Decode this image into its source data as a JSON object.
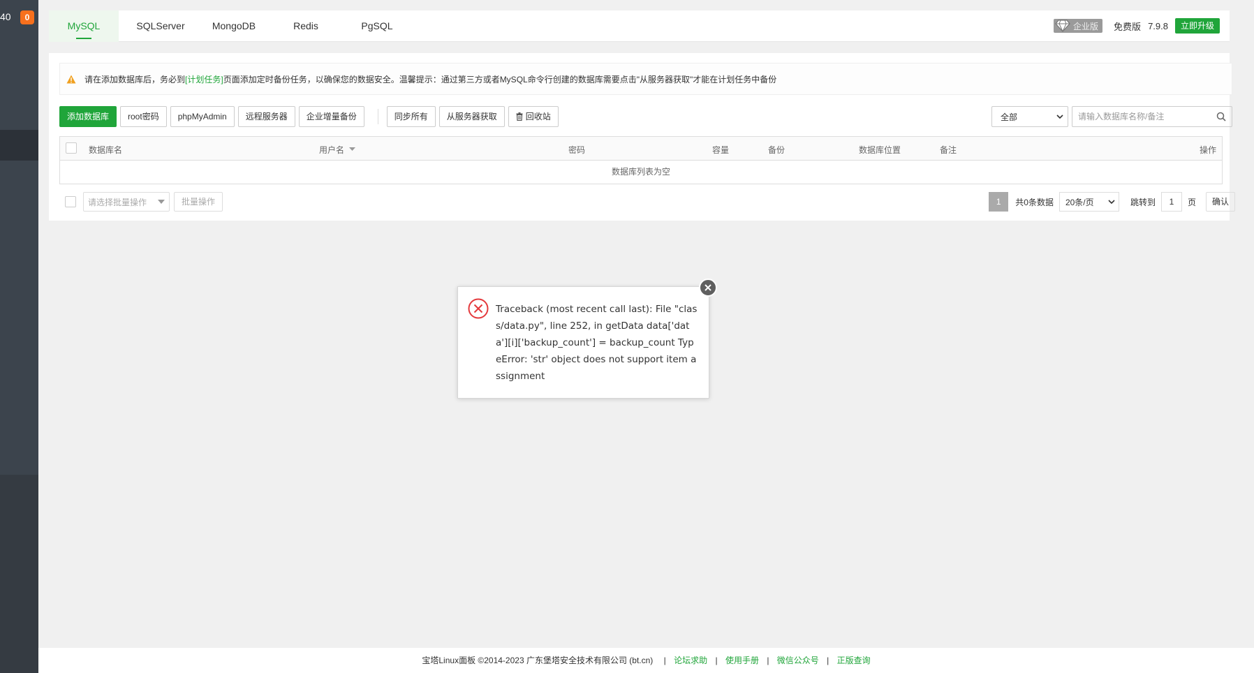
{
  "sidebar": {
    "number": "40",
    "badge": "0"
  },
  "tabs": [
    {
      "label": "MySQL",
      "active": true
    },
    {
      "label": "SQLServer",
      "active": false
    },
    {
      "label": "MongoDB",
      "active": false
    },
    {
      "label": "Redis",
      "active": false
    },
    {
      "label": "PgSQL",
      "active": false
    }
  ],
  "header_right": {
    "enterprise": "企业版",
    "free": "免费版",
    "version": "7.9.8",
    "upgrade": "立即升级"
  },
  "notice": {
    "prefix": "请在添加数据库后，务必到",
    "link": "[计划任务]",
    "suffix": "页面添加定时备份任务，以确保您的数据安全。温馨提示：通过第三方或者MySQL命令行创建的数据库需要点击\"从服务器获取\"才能在计划任务中备份"
  },
  "toolbar": {
    "add_db": "添加数据库",
    "root_pwd": "root密码",
    "phpmyadmin": "phpMyAdmin",
    "remote": "远程服务器",
    "enterprise_backup": "企业增量备份",
    "sync_all": "同步所有",
    "from_server": "从服务器获取",
    "recycle": "回收站"
  },
  "filter": {
    "selected": "全部",
    "search_placeholder": "请输入数据库名称/备注"
  },
  "table": {
    "headers": {
      "name": "数据库名",
      "user": "用户名",
      "password": "密码",
      "capacity": "容量",
      "backup": "备份",
      "location": "数据库位置",
      "note": "备注",
      "ops": "操作"
    },
    "empty": "数据库列表为空"
  },
  "batch": {
    "placeholder": "请选择批量操作",
    "button": "批量操作"
  },
  "pager": {
    "current": "1",
    "total": "共0条数据",
    "per_page": "20条/页",
    "jump_label": "跳转到",
    "jump_value": "1",
    "page_unit": "页",
    "confirm": "确认"
  },
  "error_dialog": {
    "message": "Traceback (most recent call last): File \"class/data.py\", line 252, in getData data['data'][i]['backup_count'] = backup_count TypeError: 'str' object does not support item assignment"
  },
  "footer": {
    "copyright": "宝塔Linux面板 ©2014-2023 广东堡塔安全技术有限公司 (bt.cn)",
    "links": [
      "论坛求助",
      "使用手册",
      "微信公众号",
      "正版查询"
    ]
  },
  "colors": {
    "accent": "#20a53a",
    "badge": "#f7701d",
    "sidebar": "#3c444d",
    "error": "#e4393c"
  }
}
